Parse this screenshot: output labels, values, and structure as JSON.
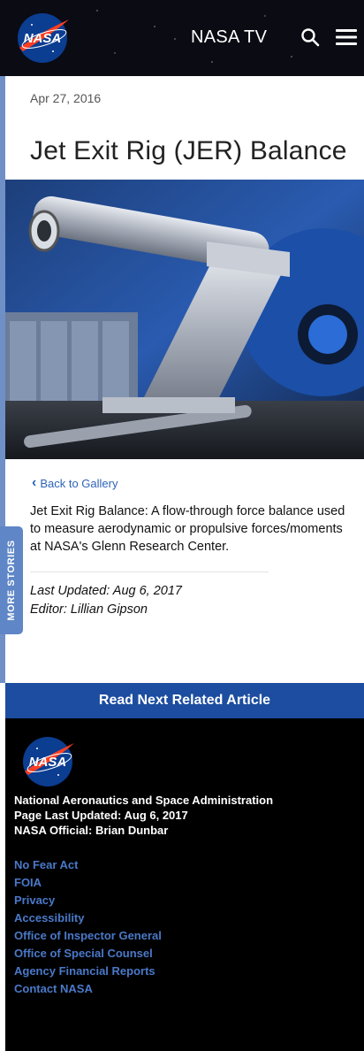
{
  "header": {
    "logo_text": "NASA",
    "nasa_tv_label": "NASA TV"
  },
  "article": {
    "date": "Apr 27, 2016",
    "title": "Jet Exit Rig (JER) Balance",
    "back_link": "Back to Gallery",
    "description": "Jet Exit Rig Balance: A flow-through force balance used to measure aerodynamic or propulsive forces/moments at NASA's Glenn Research Center.",
    "last_updated": "Last Updated: Aug 6, 2017",
    "editor": "Editor: Lillian Gipson"
  },
  "more_stories_label": "MORE STORIES",
  "read_next_label": "Read Next Related Article",
  "footer": {
    "logo_text": "NASA",
    "agency_lines": [
      "National Aeronautics and Space Administration",
      "Page Last Updated: Aug 6, 2017",
      "NASA Official: Brian Dunbar"
    ],
    "links": [
      "No Fear Act",
      "FOIA",
      "Privacy",
      "Accessibility",
      "Office of Inspector General",
      "Office of Special Counsel",
      "Agency Financial Reports",
      "Contact NASA"
    ]
  },
  "colors": {
    "header_bg": "#0b0b14",
    "accent_blue": "#1c4da0",
    "link_blue": "#2e63b8",
    "footer_link": "#4a79c9",
    "sidebar_tab": "#5f86c6"
  }
}
